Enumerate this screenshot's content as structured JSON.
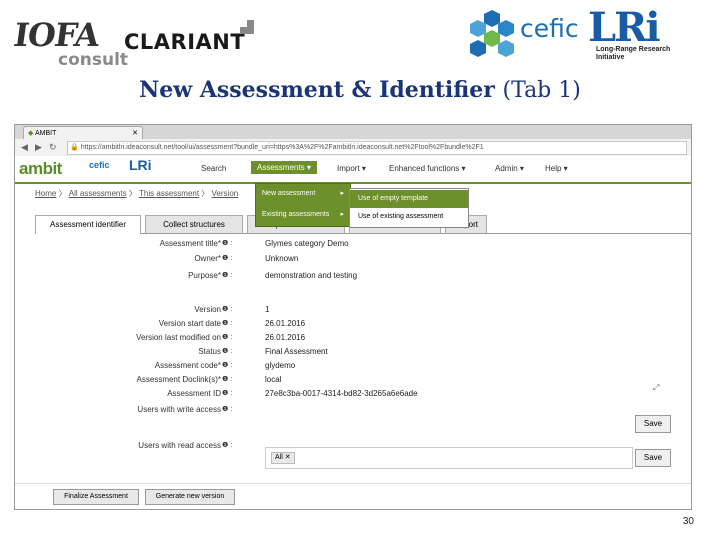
{
  "slide": {
    "title_main": "New Assessment & Identifier",
    "title_tab": "(Tab 1)",
    "page_number": "30"
  },
  "logos": {
    "iofa": "IOFA",
    "iofa_sub": "consult",
    "clariant": "CLARIANT",
    "cefic": "cefic",
    "lri": "LRi",
    "lri_sub": "Long-Range Research Initiative"
  },
  "browser": {
    "tab_title": "AMBIT",
    "url": "https://ambitlri.ideaconsult.net/tool/ui/assessment?bundle_uri=https%3A%2F%2Fambitlri.ideaconsult.net%2Ftool%2Fbundle%2F1"
  },
  "app": {
    "brand": "ambit",
    "menu": [
      "Search",
      "Assessments",
      "Import",
      "Enhanced functions",
      "Admin",
      "Help"
    ],
    "breadcrumb": [
      "Home",
      "All assessments",
      "This assessment",
      "Version"
    ],
    "dropdown": [
      "New assessment",
      "Existing assessments"
    ],
    "submenu": [
      "Use of empty template",
      "Use of existing assessment"
    ],
    "tabs": [
      "Assessment identifier",
      "Collect structures",
      "Endpoint data used",
      "",
      "Report"
    ]
  },
  "form": {
    "fields": [
      {
        "label": "Assessment title*",
        "value": "Glymes category Demo"
      },
      {
        "label": "Owner*",
        "value": "Unknown"
      },
      {
        "label": "Purpose*",
        "value": "demonstration and testing"
      },
      {
        "label": "Version",
        "value": "1"
      },
      {
        "label": "Version start date",
        "value": "26.01.2016"
      },
      {
        "label": "Version last modified on",
        "value": "26.01.2016"
      },
      {
        "label": "Status",
        "value": "Final Assessment"
      },
      {
        "label": "Assessment code*",
        "value": "glydemo"
      },
      {
        "label": "Assessment Doclink(s)*",
        "value": "local"
      },
      {
        "label": "Assessment ID",
        "value": "27e8c3ba-0017-4314-bd82-3d265a6e6ade"
      },
      {
        "label": "Users with write access",
        "value": ""
      },
      {
        "label": "Users with read access",
        "value": ""
      }
    ],
    "read_chip": "All",
    "save_label": "Save",
    "finalize_label": "Finalize Assessment",
    "new_version_label": "Generate new version"
  },
  "colors": {
    "accent_green": "#6d8f2c",
    "title_blue": "#1b3478"
  }
}
